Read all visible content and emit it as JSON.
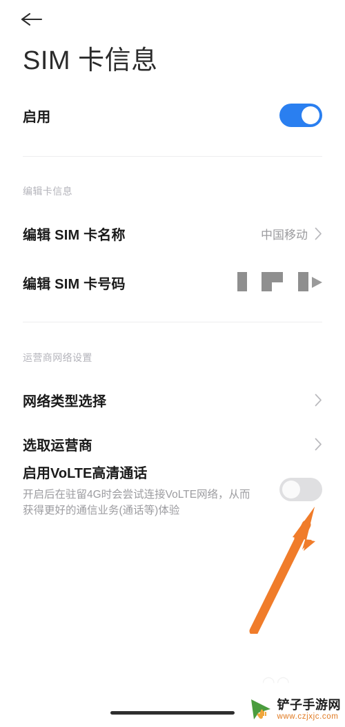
{
  "screen": {
    "app": "settings",
    "page_title": "SIM 卡信息",
    "back_icon": "back-arrow-icon"
  },
  "enable_row": {
    "label": "启用",
    "toggle_state": "on",
    "toggle_color": "#2a7ff0"
  },
  "sections": [
    {
      "header": "编辑卡信息",
      "rows": [
        {
          "label": "编辑 SIM 卡名称",
          "value": "中国移动",
          "accessory": "chevron-right-icon"
        },
        {
          "label": "编辑 SIM 卡号码",
          "value": "",
          "value_redacted": true,
          "accessory": "chevron-right-icon"
        }
      ]
    },
    {
      "header": "运营商网络设置",
      "rows": [
        {
          "label": "网络类型选择",
          "value": "",
          "accessory": "chevron-right-icon"
        },
        {
          "label": "选取运营商",
          "value": "",
          "accessory": "chevron-right-icon"
        }
      ]
    }
  ],
  "volte": {
    "title": "启用VoLTE高清通话",
    "description": "开启后在驻留4G时会尝试连接VoLTE网络，从而获得更好的通信业务(通话等)体验",
    "toggle_state": "off",
    "toggle_color": "#dfdfe1"
  },
  "annotation": {
    "type": "arrow",
    "color": "#f07c2a",
    "points_to": "volte-toggle"
  },
  "watermark": {
    "site_name": "铲子手游网",
    "url": "www.czjxjc.com",
    "logo_color": "#4a9c3e",
    "cursor_color": "#f0a63c",
    "url_color": "#e07a22"
  },
  "system": {
    "home_indicator": true
  }
}
